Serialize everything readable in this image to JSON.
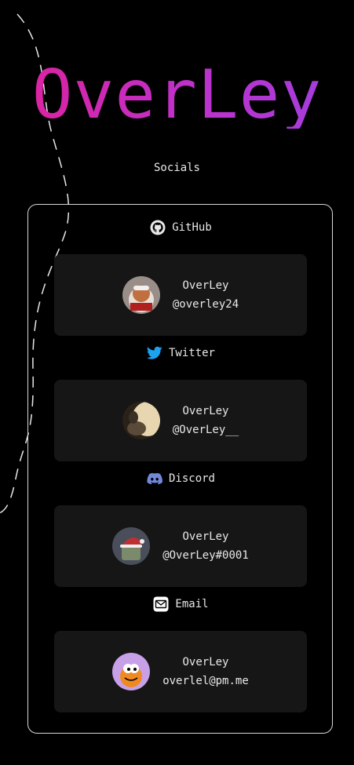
{
  "page": {
    "title": "OverLey",
    "subtitle": "Socials"
  },
  "sections": [
    {
      "label": "GitHub",
      "icon": "github-icon",
      "name": "OverLey",
      "handle": "@overley24"
    },
    {
      "label": "Twitter",
      "icon": "twitter-icon",
      "name": "OverLey",
      "handle": "@OverLey__"
    },
    {
      "label": "Discord",
      "icon": "discord-icon",
      "name": "OverLey",
      "handle": "@OverLey#0001"
    },
    {
      "label": "Email",
      "icon": "email-icon",
      "name": "OverLey",
      "handle": "overlel@pm.me"
    }
  ],
  "colors": {
    "background": "#000000",
    "title_gradient_start": "#e0209a",
    "title_gradient_end": "#a040e0",
    "card_background": "#161616",
    "panel_border": "#d8d8d8",
    "twitter_blue": "#1da1f2",
    "discord_blurple": "#7289da"
  }
}
